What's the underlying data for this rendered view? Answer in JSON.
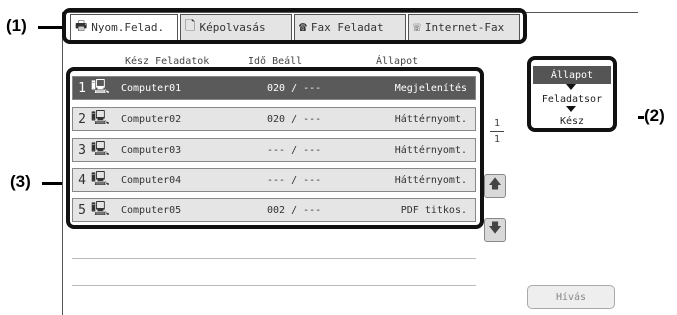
{
  "callouts": {
    "c1": "(1)",
    "c2": "(2)",
    "c3": "(3)"
  },
  "tabs": [
    {
      "label": "Nyom.Felad.",
      "icon": "printer-icon",
      "glyph": "🖶"
    },
    {
      "label": "Képolvasás",
      "icon": "scan-icon",
      "glyph": "🗋"
    },
    {
      "label": "Fax Feladat",
      "icon": "fax-icon",
      "glyph": "☎"
    },
    {
      "label": "Internet-Fax",
      "icon": "internet-fax-icon",
      "glyph": "☏"
    }
  ],
  "headers": {
    "jobs": "Kész Feladatok",
    "time": "Idő Beáll",
    "status": "Állapot"
  },
  "jobs": [
    {
      "num": "1",
      "name": "Computer01",
      "time": "020 / ---",
      "status": "Megjelenítés"
    },
    {
      "num": "2",
      "name": "Computer02",
      "time": "020 / ---",
      "status": "Háttérnyomt."
    },
    {
      "num": "3",
      "name": "Computer03",
      "time": "--- / ---",
      "status": "Háttérnyomt."
    },
    {
      "num": "4",
      "name": "Computer04",
      "time": "--- / ---",
      "status": "Háttérnyomt."
    },
    {
      "num": "5",
      "name": "Computer05",
      "time": "002 / ---",
      "status": "PDF titkos."
    }
  ],
  "pager": {
    "current": "1",
    "total": "1"
  },
  "state": {
    "title": "Állapot",
    "queue": "Feladatsor",
    "done": "Kész"
  },
  "call_button": "Hívás"
}
